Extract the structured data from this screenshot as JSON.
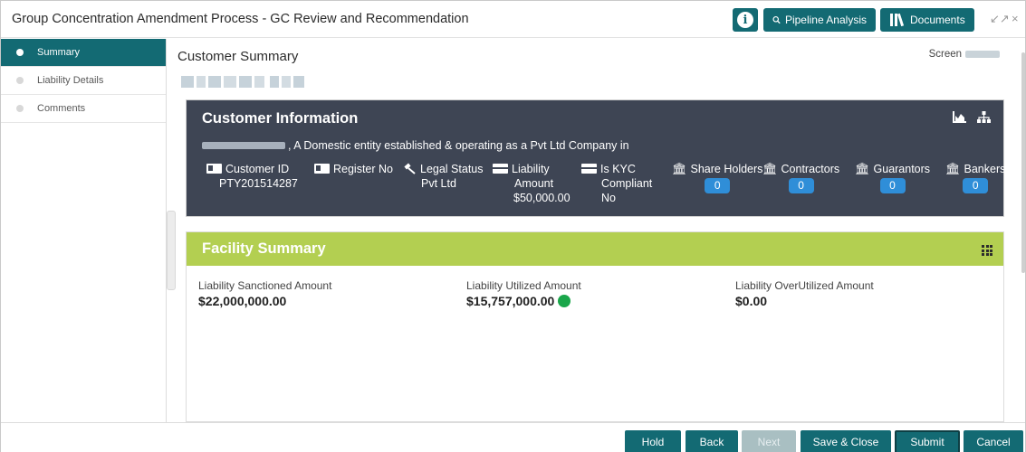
{
  "window": {
    "title": "Group Concentration Amendment Process - GC Review and Recommendation",
    "buttons": {
      "pipeline": "Pipeline Analysis",
      "documents": "Documents"
    },
    "controls": {
      "restore": "↙↗",
      "close": "×"
    }
  },
  "sidebar": {
    "items": [
      {
        "label": "Summary",
        "active": true
      },
      {
        "label": "Liability Details",
        "active": false
      },
      {
        "label": "Comments",
        "active": false
      }
    ]
  },
  "main": {
    "page_title": "Customer Summary",
    "screen_label": "Screen"
  },
  "customer_info": {
    "title": "Customer Information",
    "description": ", A Domestic entity established & operating as a Pvt Ltd Company in",
    "fields": {
      "customer_id": {
        "label": "Customer ID",
        "value": "PTY201514287"
      },
      "register_no": {
        "label": "Register No",
        "value": ""
      },
      "legal_status": {
        "label": "Legal Status",
        "value": "Pvt Ltd"
      },
      "liability_amount": {
        "label_line1": "Liability",
        "label_line2": "Amount",
        "value": "$50,000.00"
      },
      "kyc": {
        "label_line1": "Is KYC",
        "label_line2": "Compliant",
        "value": "No"
      },
      "share_holders": {
        "label": "Share Holders",
        "count": "0"
      },
      "contractors": {
        "label": "Contractors",
        "count": "0"
      },
      "guarantors": {
        "label": "Guarantors",
        "count": "0"
      },
      "bankers": {
        "label": "Bankers",
        "count": "0"
      }
    }
  },
  "facility_summary": {
    "title": "Facility Summary",
    "sanctioned": {
      "label": "Liability Sanctioned Amount",
      "value": "$22,000,000.00"
    },
    "utilized": {
      "label": "Liability Utilized Amount",
      "value": "$15,757,000.00",
      "status_color": "#1aa64a"
    },
    "overutilized": {
      "label": "Liability OverUtilized Amount",
      "value": "$0.00"
    }
  },
  "footer": {
    "hold": "Hold",
    "back": "Back",
    "next": "Next",
    "save_close": "Save & Close",
    "submit": "Submit",
    "cancel": "Cancel"
  },
  "colors": {
    "primary": "#136a73",
    "panel_dark": "#3e4554",
    "facility_header": "#b3cf51",
    "badge": "#2f8ed8"
  }
}
